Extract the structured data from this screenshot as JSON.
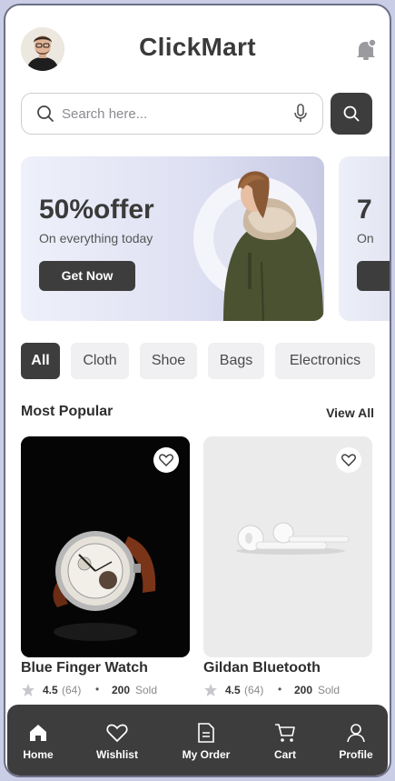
{
  "header": {
    "app_title": "ClickMart"
  },
  "search": {
    "placeholder": "Search here..."
  },
  "banners": [
    {
      "headline": "50%offer",
      "subtitle": "On everything today",
      "cta": "Get Now"
    },
    {
      "headline": "7",
      "subtitle": "On"
    }
  ],
  "categories": [
    "All",
    "Cloth",
    "Shoe",
    "Bags",
    "Electronics"
  ],
  "popular": {
    "title": "Most Popular",
    "view_all": "View All",
    "products": [
      {
        "name": "Blue Finger Watch",
        "rating": "4.5",
        "reviews": "(64)",
        "sold": "200",
        "sold_label": "Sold"
      },
      {
        "name": "Gildan Bluetooth",
        "rating": "4.5",
        "reviews": "(64)",
        "sold": "200",
        "sold_label": "Sold"
      }
    ]
  },
  "tabbar": {
    "items": [
      {
        "label": "Home",
        "icon": "home-icon"
      },
      {
        "label": "Wishlist",
        "icon": "heart-icon"
      },
      {
        "label": "My Order",
        "icon": "document-icon"
      },
      {
        "label": "Cart",
        "icon": "cart-icon"
      },
      {
        "label": "Profile",
        "icon": "user-icon"
      }
    ]
  },
  "colors": {
    "primary": "#3d3d3d",
    "chip_bg": "#f0f0f2",
    "background": "#ffffff"
  }
}
